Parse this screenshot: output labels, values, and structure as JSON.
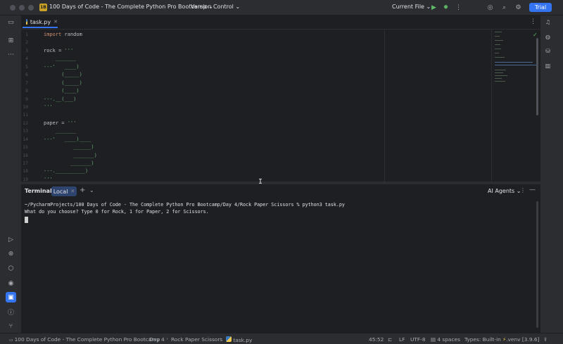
{
  "titlebar": {
    "project_badge": "1B",
    "project_name": "100 Days of Code - The Complete Python Pro Bootcamp",
    "vcs_label": "Version Control",
    "run_config": "Current File",
    "trial_label": "Trial"
  },
  "editor": {
    "tab_label": "task.py",
    "line_numbers": [
      "1",
      "2",
      "3",
      "4",
      "5",
      "6",
      "7",
      "8",
      "9",
      "10",
      "11",
      "12",
      "13",
      "14",
      "15",
      "16",
      "17",
      "18",
      "19"
    ],
    "lines": [
      {
        "keyword": "import",
        "text": " random"
      },
      {
        "keyword": "",
        "text": ""
      },
      {
        "keyword": "",
        "text": "rock = '''"
      },
      {
        "keyword": "",
        "text": "    _______"
      },
      {
        "keyword": "",
        "text": "---'   ____)"
      },
      {
        "keyword": "",
        "text": "      (_____)"
      },
      {
        "keyword": "",
        "text": "      (_____)"
      },
      {
        "keyword": "",
        "text": "      (____)"
      },
      {
        "keyword": "",
        "text": "---.__(___)"
      },
      {
        "keyword": "",
        "text": "'''"
      },
      {
        "keyword": "",
        "text": ""
      },
      {
        "keyword": "",
        "text": "paper = '''"
      },
      {
        "keyword": "",
        "text": "    _______"
      },
      {
        "keyword": "",
        "text": "---'   ____)____"
      },
      {
        "keyword": "",
        "text": "          ______)"
      },
      {
        "keyword": "",
        "text": "          _______)"
      },
      {
        "keyword": "",
        "text": "         _______)"
      },
      {
        "keyword": "",
        "text": "---.__________)"
      },
      {
        "keyword": "",
        "text": "'''"
      }
    ]
  },
  "terminal": {
    "title": "Terminal",
    "tab_label": "Local",
    "ai_label": "AI Agents",
    "lines": [
      "~/PycharmProjects/100 Days of Code - The Complete Python Pro Bootcamp/Day 4/Rock Paper Scissors % python3 task.py",
      "What do you choose? Type 0 for Rock, 1 for Paper, 2 for Scissors."
    ]
  },
  "statusbar": {
    "crumbs": [
      "100 Days of Code - The Complete Python Pro Bootcamp",
      "Day 4",
      "Rock Paper Scissors",
      "task.py"
    ],
    "position": "45:52",
    "line_ending": "LF",
    "encoding": "UTF-8",
    "indent": "4 spaces",
    "types": "Types: Built-in",
    "interpreter": ".venv [3.9.6]"
  }
}
